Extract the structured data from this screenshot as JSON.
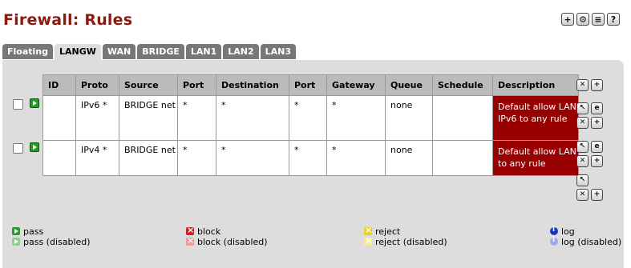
{
  "page": {
    "title": "Firewall: Rules"
  },
  "top_icons": [
    "add-icon",
    "settings-icon",
    "log-icon",
    "help-icon"
  ],
  "tabs": [
    {
      "label": "Floating",
      "active": false
    },
    {
      "label": "LANGW",
      "active": true
    },
    {
      "label": "WAN",
      "active": false
    },
    {
      "label": "BRIDGE",
      "active": false
    },
    {
      "label": "LAN1",
      "active": false
    },
    {
      "label": "LAN2",
      "active": false
    },
    {
      "label": "LAN3",
      "active": false
    }
  ],
  "table": {
    "headers": [
      "ID",
      "Proto",
      "Source",
      "Port",
      "Destination",
      "Port",
      "Gateway",
      "Queue",
      "Schedule",
      "Description"
    ],
    "rows": [
      {
        "id": "",
        "proto": "IPv6 *",
        "source": "BRIDGE net",
        "port": "*",
        "destination": "*",
        "dest_port": "*",
        "gateway": "*",
        "queue": "none",
        "schedule": "",
        "description": "Default allow LAN IPv6 to any rule"
      },
      {
        "id": "",
        "proto": "IPv4 *",
        "source": "BRIDGE net",
        "port": "*",
        "destination": "*",
        "dest_port": "*",
        "gateway": "*",
        "queue": "none",
        "schedule": "",
        "description": "Default allow LAN to any rule"
      }
    ]
  },
  "legend": {
    "pass": "pass",
    "pass_disabled": "pass (disabled)",
    "block": "block",
    "block_disabled": "block (disabled)",
    "reject": "reject",
    "reject_disabled": "reject (disabled)",
    "log": "log",
    "log_disabled": "log (disabled)"
  },
  "colors": {
    "title": "#8b1a10",
    "description_bg": "#990000",
    "tab": "#777777",
    "panel": "#dddddd"
  }
}
